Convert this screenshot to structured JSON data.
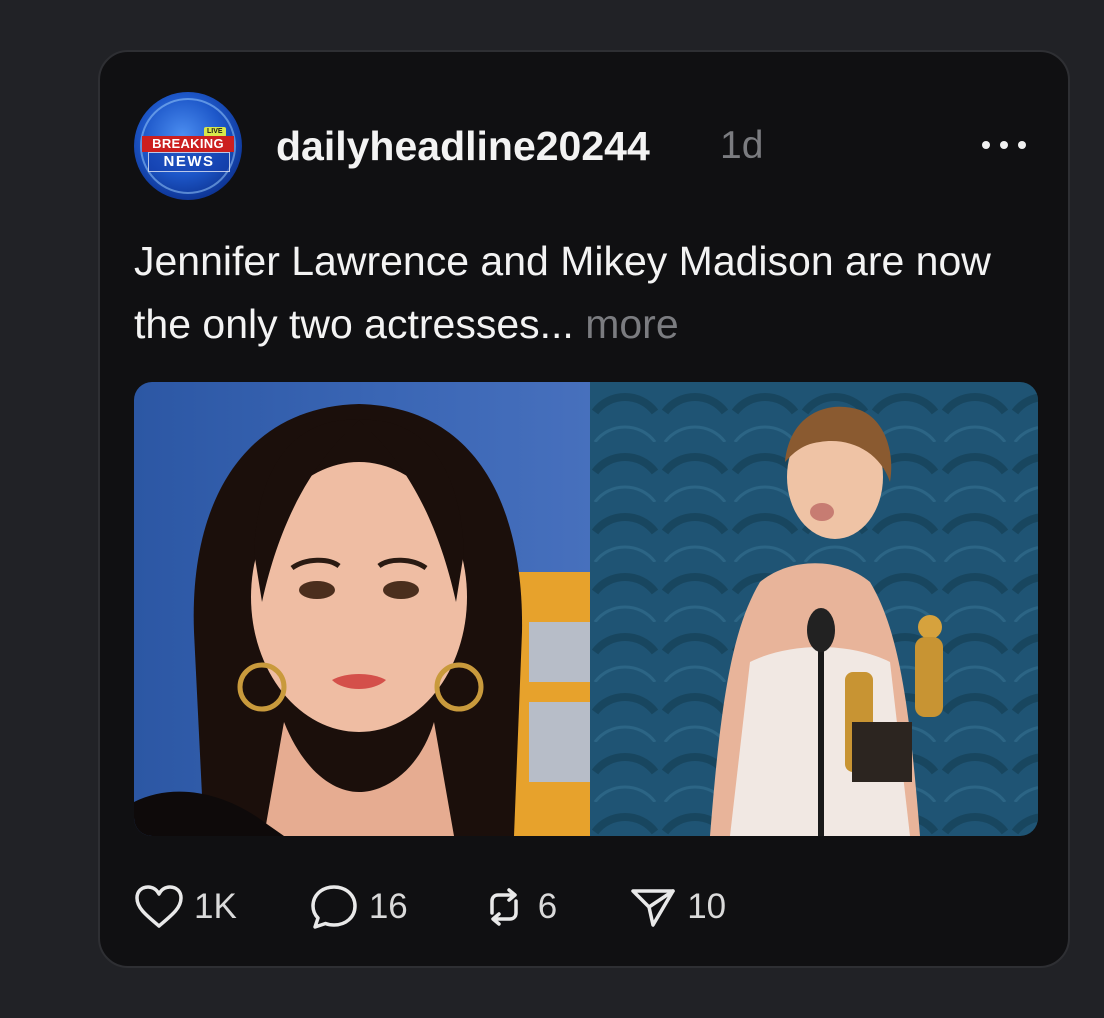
{
  "post": {
    "username": "dailyheadline20244",
    "time": "1d",
    "text": "Jennifer Lawrence and Mikey Madison are now the only two actresses...",
    "more_label": "more",
    "avatar": {
      "live_label": "LIVE",
      "line1": "BREAKING",
      "line2": "NEWS"
    }
  },
  "actions": {
    "likes": "1K",
    "comments": "16",
    "reposts": "6",
    "shares": "10"
  },
  "icons": [
    "heart-icon",
    "comment-icon",
    "repost-icon",
    "send-icon",
    "more-options-icon"
  ],
  "colors": {
    "background": "#212226",
    "card": "#101012",
    "text": "#f3f3f3",
    "muted": "#7b7c80"
  }
}
